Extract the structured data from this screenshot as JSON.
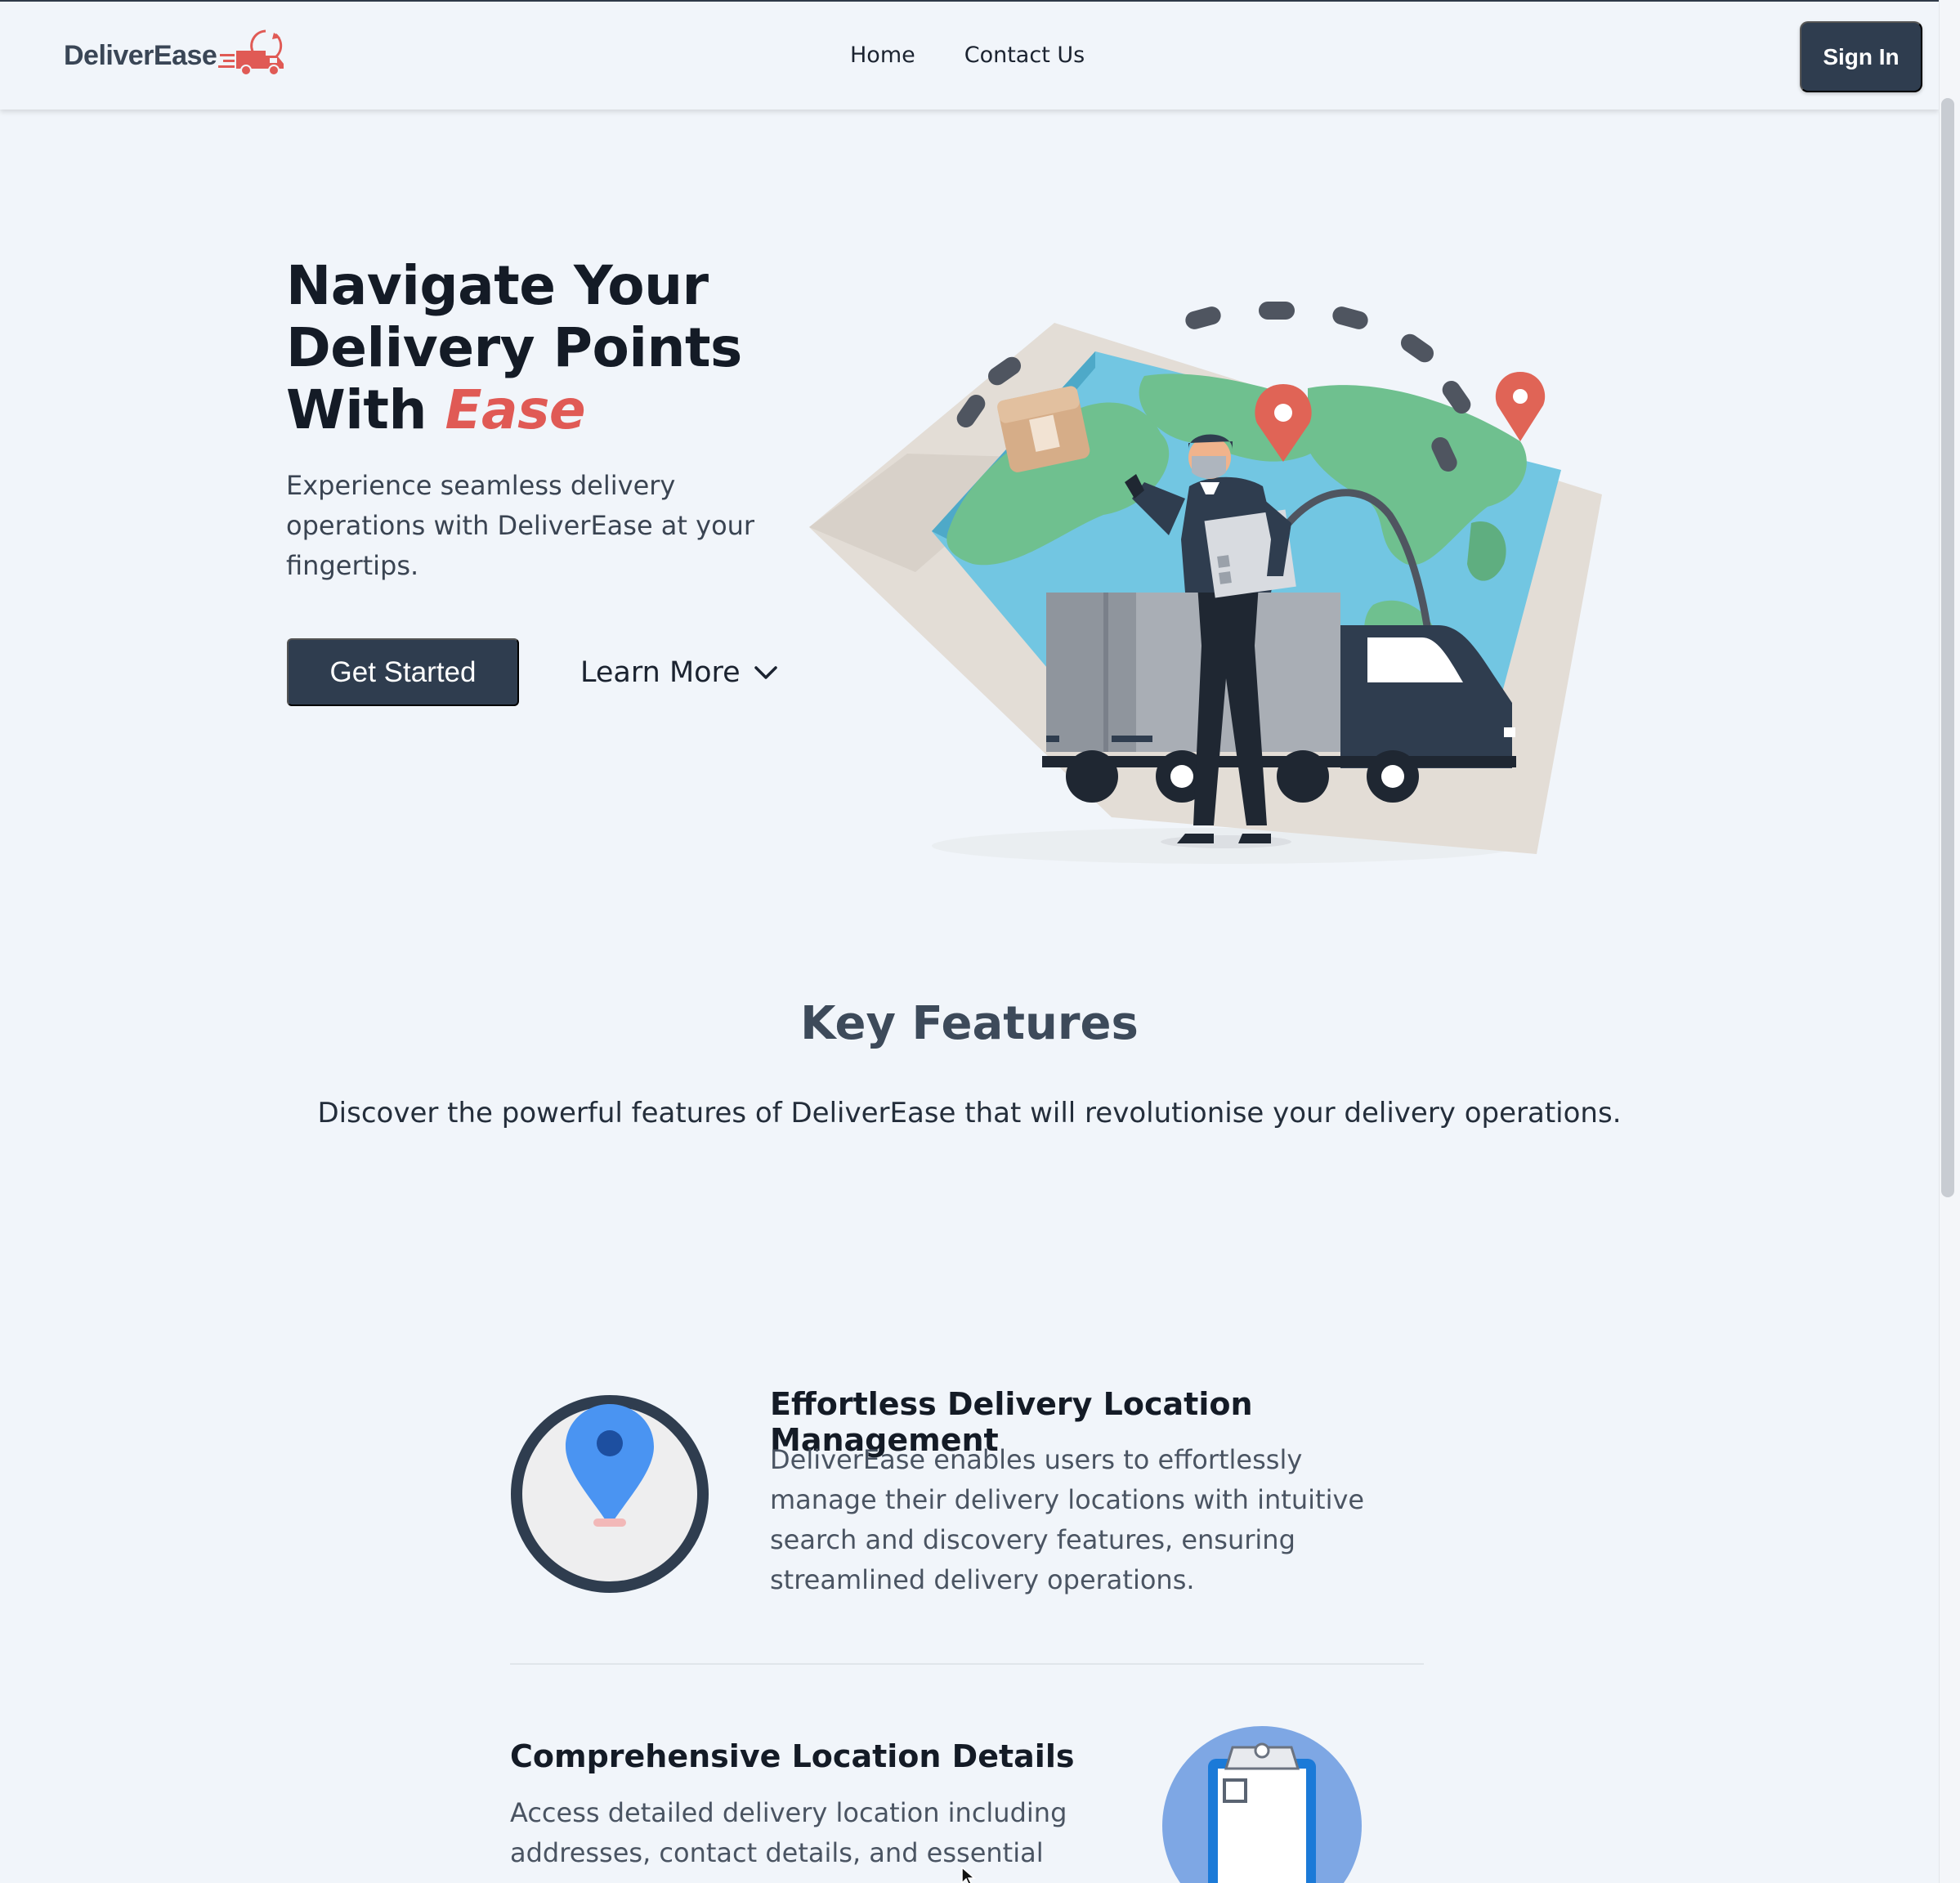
{
  "navbar": {
    "logo_text": "DeliverEase",
    "links": [
      {
        "label": "Home"
      },
      {
        "label": "Contact Us"
      }
    ],
    "signin_label": "Sign In"
  },
  "hero": {
    "title_line1": "Navigate Your",
    "title_line2": "Delivery Points",
    "title_with": "With",
    "title_accent": "Ease",
    "subtitle": "Experience seamless delivery operations with DeliverEase at your fingertips.",
    "get_started_label": "Get Started",
    "learn_more_label": "Learn More"
  },
  "features": {
    "title": "Key Features",
    "subtitle": "Discover the powerful features of DeliverEase that will revolutionise your delivery operations.",
    "items": [
      {
        "title": "Effortless Delivery Location Management",
        "description": "DeliverEase enables users to effortlessly manage their delivery locations with intuitive search and discovery features, ensuring streamlined delivery operations.",
        "icon": "location-pin-icon"
      },
      {
        "title": "Comprehensive Location Details",
        "description": "Access detailed delivery location including addresses, contact details, and essential notes,",
        "icon": "clipboard-icon"
      }
    ]
  },
  "colors": {
    "primary": "#2f3d4f",
    "accent": "#e05a55",
    "background": "#f1f5fa"
  }
}
